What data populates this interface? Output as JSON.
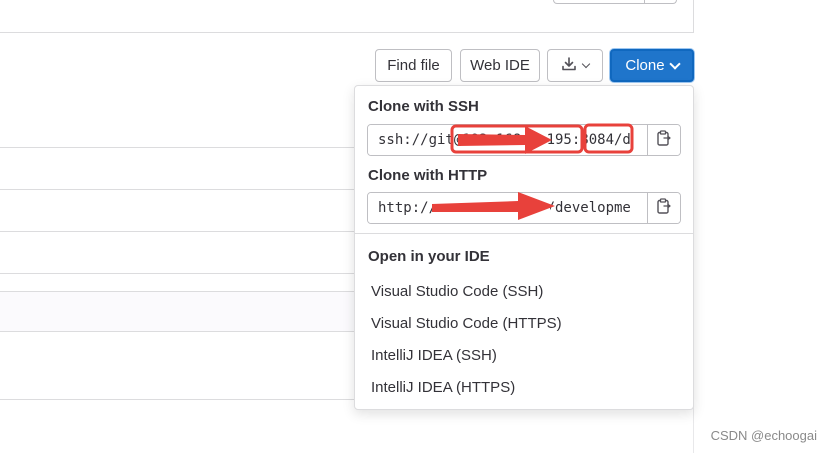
{
  "toolbar": {
    "find_file_label": "Find file",
    "web_ide_label": "Web IDE",
    "download_icon": "download-icon",
    "clone_label": "Clone"
  },
  "clone_dropdown": {
    "ssh_heading": "Clone with SSH",
    "ssh_url": "ssh://git@192.168.1.195:8084/d",
    "http_heading": "Clone with HTTP",
    "http_url": "http://192.168.1.195/developme",
    "ide_heading": "Open in your IDE",
    "ide_options": [
      "Visual Studio Code (SSH)",
      "Visual Studio Code (HTTPS)",
      "IntelliJ IDEA (SSH)",
      "IntelliJ IDEA (HTTPS)"
    ]
  },
  "watermark": "CSDN @echoogai",
  "colors": {
    "accent": "#1f75cb",
    "annotation": "#e8413b"
  }
}
